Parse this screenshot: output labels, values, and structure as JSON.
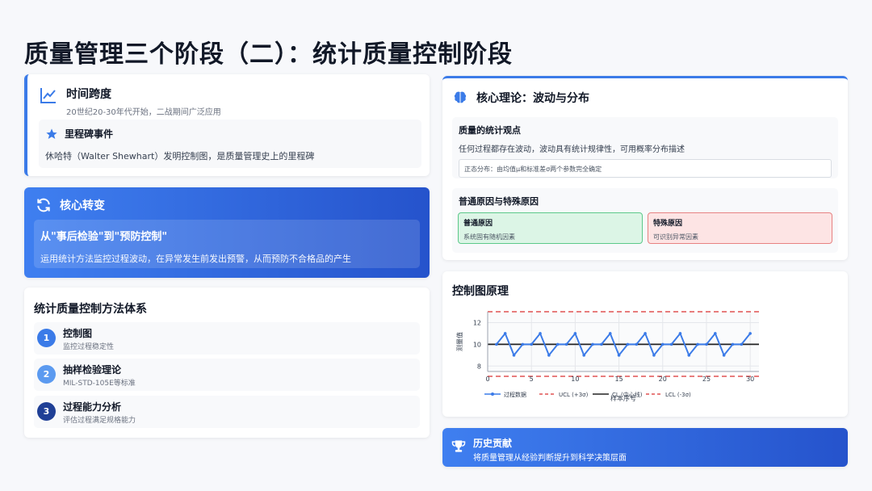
{
  "page": {
    "title": "质量管理三个阶段（二）：统计质量控制阶段"
  },
  "time_span": {
    "title": "时间跨度",
    "subtitle": "20世纪20-30年代开始，二战期间广泛应用",
    "icon": "chart-line-icon",
    "milestone": {
      "icon": "star-icon",
      "title": "里程碑事件",
      "text": "休哈特（Walter Shewhart）发明控制图，是质量管理史上的里程碑"
    }
  },
  "core_transform": {
    "icon": "refresh-icon",
    "title": "核心转变",
    "headline": "从\"事后检验\"到\"预防控制\"",
    "description": "运用统计方法监控过程波动，在异常发生前发出预警，从而预防不合格品的产生"
  },
  "methods": {
    "title": "统计质量控制方法体系",
    "items": [
      {
        "num": "1",
        "name": "控制图",
        "desc": "监控过程稳定性",
        "color": "#3b7be8"
      },
      {
        "num": "2",
        "name": "抽样检验理论",
        "desc": "MIL-STD-105E等标准",
        "color": "#5b9af0"
      },
      {
        "num": "3",
        "name": "过程能力分析",
        "desc": "评估过程满足规格能力",
        "color": "#1f3f96"
      }
    ]
  },
  "core_theory": {
    "icon": "brain-icon",
    "title": "核心理论：波动与分布",
    "stat_view": {
      "title": "质量的统计观点",
      "text": "任何过程都存在波动，波动具有统计规律性，可用概率分布描述",
      "normal_dist": "正态分布：由均值μ和标准差σ两个参数完全确定"
    },
    "causes": {
      "title": "普通原因与特殊原因",
      "common": {
        "title": "普通原因",
        "desc": "系统固有随机因素"
      },
      "special": {
        "title": "特殊原因",
        "desc": "可识别异常因素"
      }
    }
  },
  "chart_section": {
    "title": "控制图原理"
  },
  "chart_data": {
    "type": "line",
    "title": "",
    "xlabel": "样本序号",
    "ylabel": "测量值",
    "xlim": [
      0,
      31
    ],
    "ylim": [
      7.5,
      13
    ],
    "x_ticks": [
      "0",
      "5",
      "10",
      "15",
      "20",
      "25",
      "30"
    ],
    "y_ticks": [
      "8",
      "10",
      "12"
    ],
    "series": [
      {
        "name": "过程数据",
        "x": [
          1,
          2,
          3,
          4,
          5,
          6,
          7,
          8,
          9,
          10,
          11,
          12,
          13,
          14,
          15,
          16,
          17,
          18,
          19,
          20,
          21,
          22,
          23,
          24,
          25,
          26,
          27,
          28,
          29,
          30
        ],
        "values": [
          10,
          11,
          9,
          10,
          10,
          11,
          9,
          10,
          10,
          11,
          9,
          10,
          10,
          11,
          9,
          10,
          10,
          11,
          9,
          10,
          10,
          11,
          9,
          10,
          10,
          11,
          9,
          10,
          10,
          11
        ],
        "color": "#3b7be8"
      }
    ],
    "reference_lines": [
      {
        "name": "UCL (+3σ)",
        "value": 13,
        "color": "#e05252",
        "style": "dashed"
      },
      {
        "name": "CL (中心线)",
        "value": 10,
        "color": "#222222",
        "style": "solid"
      },
      {
        "name": "LCL (-3σ)",
        "value": 7,
        "color": "#e05252",
        "style": "dashed"
      }
    ],
    "legend_position": "bottom",
    "grid": true
  },
  "contribution": {
    "icon": "trophy-icon",
    "title": "历史贡献",
    "description": "将质量管理从经验判断提升到科学决策层面"
  }
}
